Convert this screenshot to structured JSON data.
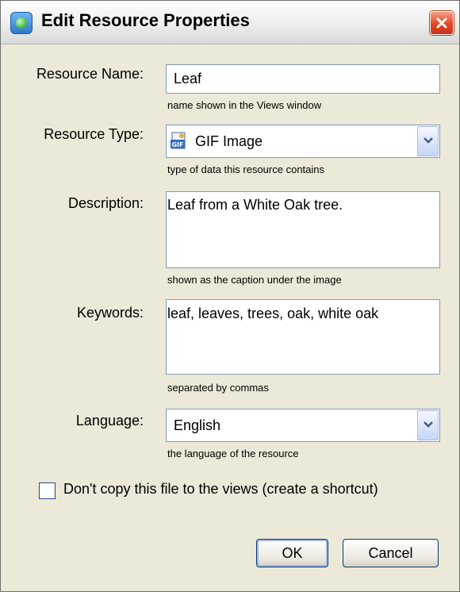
{
  "window": {
    "title": "Edit Resource Properties",
    "title_icon": "app-icon",
    "close_icon": "close-icon"
  },
  "fields": {
    "resource_name": {
      "label": "Resource Name:",
      "value": "Leaf",
      "hint": "name shown in the Views window"
    },
    "resource_type": {
      "label": "Resource Type:",
      "value": "GIF Image",
      "icon": "gif-file-icon",
      "hint": "type of data this resource contains"
    },
    "description": {
      "label": "Description:",
      "value": "Leaf from a White Oak tree.",
      "hint": "shown as the caption under the image"
    },
    "keywords": {
      "label": "Keywords:",
      "value": "leaf, leaves, trees, oak, white oak",
      "hint": "separated by commas"
    },
    "language": {
      "label": "Language:",
      "value": "English",
      "hint": "the language of the resource"
    }
  },
  "options": {
    "no_copy": {
      "label": "Don't copy this file to the views (create a shortcut)",
      "checked": false
    }
  },
  "buttons": {
    "ok": "OK",
    "cancel": "Cancel"
  }
}
